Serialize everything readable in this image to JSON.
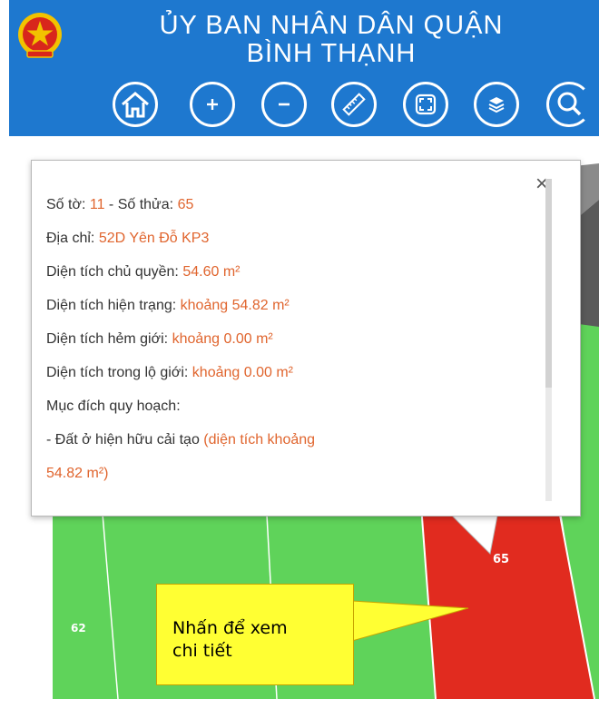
{
  "header": {
    "title_line1": "ỦY BAN NHÂN DÂN QUẬN",
    "title_line2": "BÌNH THẠNH",
    "background": "#1e78cf",
    "emblem": "national-emblem-icon",
    "tools": [
      {
        "name": "home-button",
        "icon": "home-icon"
      },
      {
        "name": "zoom-in-button",
        "icon": "plus-icon"
      },
      {
        "name": "zoom-out-button",
        "icon": "minus-icon"
      },
      {
        "name": "measure-button",
        "icon": "ruler-icon"
      },
      {
        "name": "fullscreen-button",
        "icon": "expand-icon"
      },
      {
        "name": "layers-button",
        "icon": "layers-icon"
      },
      {
        "name": "search-button",
        "icon": "search-icon"
      }
    ]
  },
  "map": {
    "parcel_colors": {
      "green": "#5fd35a",
      "red": "#e12b1f",
      "gray": "#8a8a8a"
    },
    "labels": {
      "parcel_left": "62",
      "parcel_selected": "65"
    }
  },
  "popup": {
    "close": "×",
    "rows": [
      {
        "label": "Số tờ:",
        "value": "11",
        "label2": "- Số thửa:",
        "value2": "65"
      },
      {
        "label": "Địa chỉ:",
        "value": "52D Yên Đỗ KP3"
      },
      {
        "label": "Diện tích chủ quyền:",
        "value": "54.60 m²"
      },
      {
        "label": "Diện tích hiện trạng:",
        "value": "khoảng 54.82 m²"
      },
      {
        "label": "Diện tích hẻm giới:",
        "value": "khoảng 0.00 m²"
      },
      {
        "label": "Diện tích trong lộ giới:",
        "value": "khoảng 0.00 m²"
      },
      {
        "label": "Mục đích quy hoạch:"
      },
      {
        "label": "- Đất ở hiện hữu cải tạo",
        "value": "(diện tích khoảng"
      },
      {
        "value": "54.82 m²)"
      }
    ]
  },
  "callout": {
    "line1": "Nhấn để xem",
    "line2": "chi tiết",
    "color": "#ffff33"
  }
}
